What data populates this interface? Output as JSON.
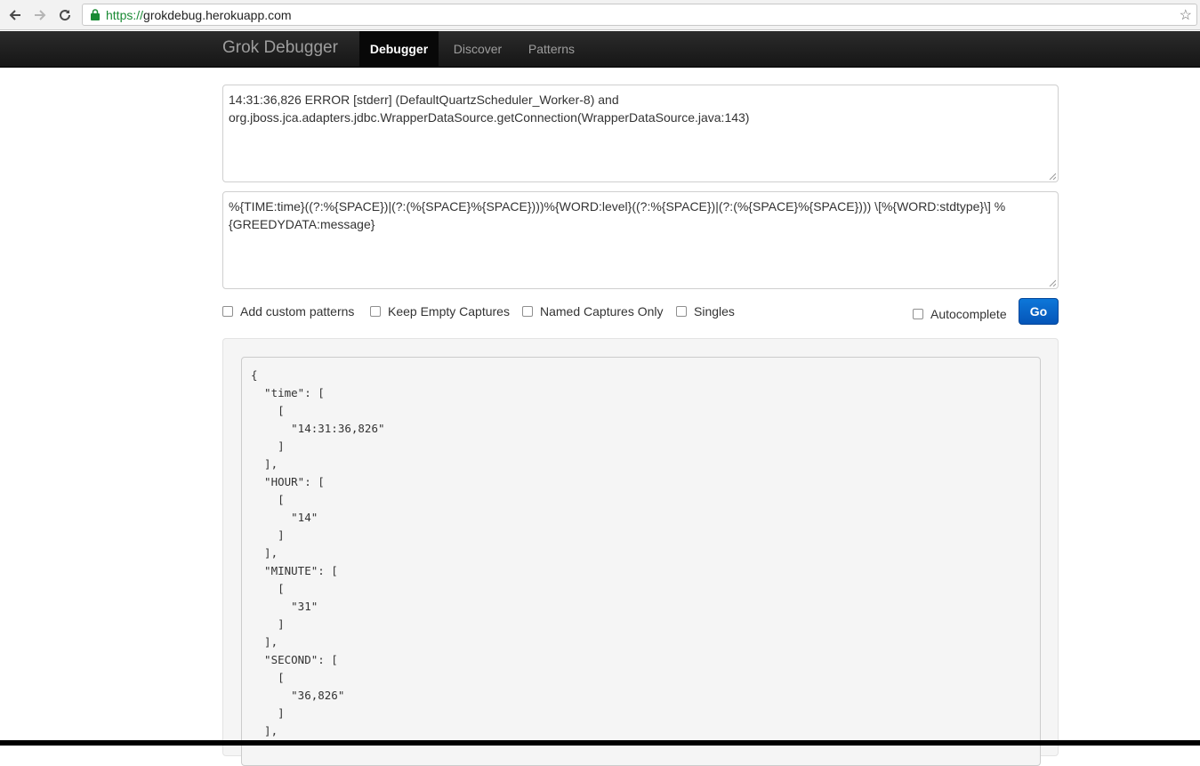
{
  "browser": {
    "url_protocol": "https://",
    "url_host": "grokdebug.herokuapp.com",
    "icons": [
      "back-arrow-icon",
      "forward-arrow-icon",
      "reload-icon",
      "lock-icon",
      "star-icon"
    ]
  },
  "navbar": {
    "brand": "Grok Debugger",
    "items": [
      {
        "label": "Debugger",
        "active": true
      },
      {
        "label": "Discover",
        "active": false
      },
      {
        "label": "Patterns",
        "active": false
      }
    ]
  },
  "input": {
    "line1": "14:31:36,826 ERROR [stderr] (DefaultQuartzScheduler_Worker-8) and",
    "line2": "org.jboss.jca.adapters.jdbc.WrapperDataSource.getConnection(WrapperDataSource.java:143)"
  },
  "pattern": {
    "line1": "%{TIME:time}((?:%{SPACE})|(?:(%{SPACE}%{SPACE})))%{WORD:level}((?:%{SPACE})|(?:(%{SPACE}%{SPACE}))) \\[%{WORD:stdtype}\\] %",
    "line2": "{GREEDYDATA:message}"
  },
  "options": {
    "add_custom_patterns": "Add custom patterns",
    "keep_empty_captures": "Keep Empty Captures",
    "named_captures_only": "Named Captures Only",
    "singles": "Singles",
    "autocomplete": "Autocomplete",
    "go": "Go"
  },
  "result": {
    "lines": [
      "{",
      "  \"time\": [",
      "    [",
      "      \"14:31:36,826\"",
      "    ]",
      "  ],",
      "  \"HOUR\": [",
      "    [",
      "      \"14\"",
      "    ]",
      "  ],",
      "  \"MINUTE\": [",
      "    [",
      "      \"31\"",
      "    ]",
      "  ],",
      "  \"SECOND\": [",
      "    [",
      "      \"36,826\"",
      "    ]",
      "  ],"
    ]
  },
  "colors": {
    "accent": "#0a66cc",
    "url_green": "#1a8a34",
    "navbar_bg": "#1c1c1c"
  }
}
